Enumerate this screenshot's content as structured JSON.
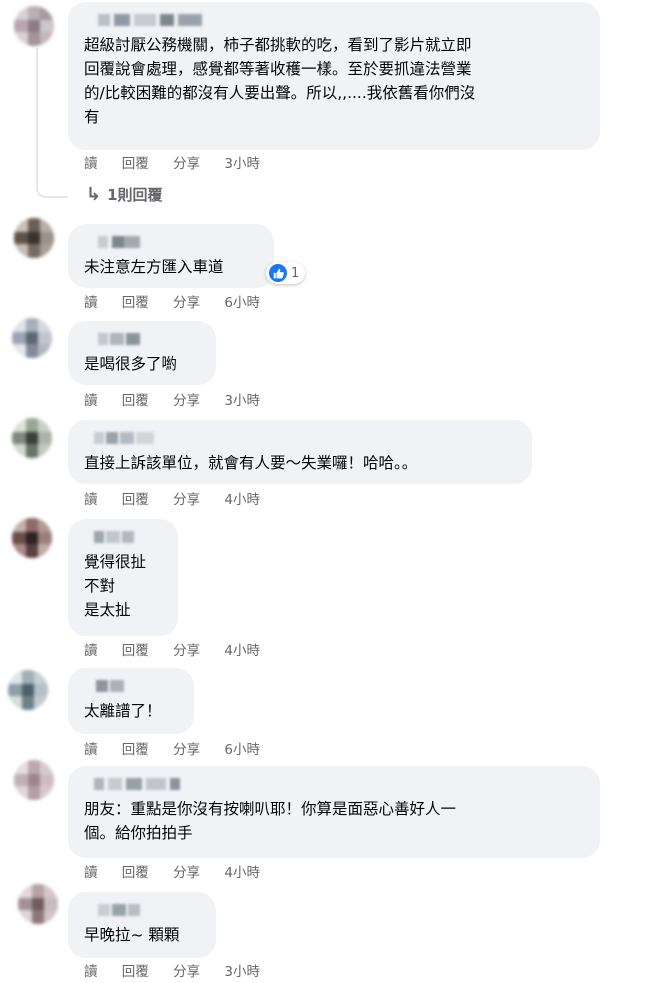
{
  "comments": [
    {
      "text": "超級討厭公務機關，柿子都挑軟的吃，看到了影片就立即\n回覆說會處理，感覺都等著收穫一樣。至於要抓違法營業\n的/比較困難的都沒有人要出聲。所以,,....我依舊看你們沒\n有",
      "actions": {
        "read": "讀",
        "reply": "回覆",
        "share": "分享",
        "time": "3小時"
      },
      "replies_label": "1則回覆"
    },
    {
      "text": "未注意左方匯入車道",
      "reaction_count": "1",
      "actions": {
        "read": "讀",
        "reply": "回覆",
        "share": "分享",
        "time": "6小時"
      }
    },
    {
      "text": "是喝很多了喲",
      "actions": {
        "read": "讀",
        "reply": "回覆",
        "share": "分享",
        "time": "3小時"
      }
    },
    {
      "text": "直接上訴該單位，就會有人要～失業囉！哈哈。。",
      "actions": {
        "read": "讀",
        "reply": "回覆",
        "share": "分享",
        "time": "4小時"
      }
    },
    {
      "text": "覺得很扯\n不對\n是太扯",
      "actions": {
        "read": "讀",
        "reply": "回覆",
        "share": "分享",
        "time": "4小時"
      }
    },
    {
      "text": "太離譜了！",
      "actions": {
        "read": "讀",
        "reply": "回覆",
        "share": "分享",
        "time": "6小時"
      }
    },
    {
      "text": "朋友：重點是你沒有按喇叭耶！你算是面惡心善好人一\n個。給你拍拍手",
      "actions": {
        "read": "讀",
        "reply": "回覆",
        "share": "分享",
        "time": "4小時"
      }
    },
    {
      "text": "早晚拉~ 顆顆",
      "actions": {
        "read": "讀",
        "reply": "回覆",
        "share": "分享",
        "time": "3小時"
      }
    }
  ],
  "colors": {
    "bubble": "#f0f2f5",
    "secondary_text": "#65676b",
    "like_blue": "#1877f2"
  },
  "icons": {
    "reply_arrow": "reply-arrow-icon",
    "like": "like-icon"
  }
}
